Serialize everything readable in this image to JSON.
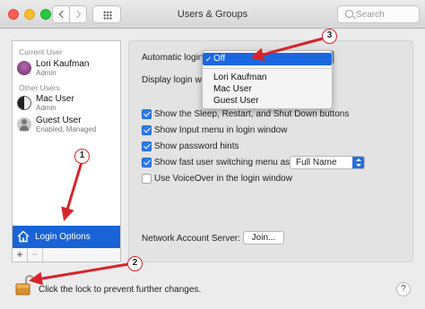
{
  "window": {
    "title": "Users & Groups",
    "search_placeholder": "Search"
  },
  "sidebar": {
    "current_user_header": "Current User",
    "other_users_header": "Other Users",
    "users": [
      {
        "name": "Lori Kaufman",
        "role": "Admin",
        "avatar": "photo-avatar"
      },
      {
        "name": "Mac User",
        "role": "Admin",
        "avatar": "yin-yang-avatar"
      },
      {
        "name": "Guest User",
        "role": "Enabled, Managed",
        "avatar": "guest-avatar"
      }
    ],
    "login_options_label": "Login Options",
    "add_label": "+",
    "remove_label": "−"
  },
  "panel": {
    "automatic_login_label": "Automatic login:",
    "display_login_label": "Display login window as:",
    "automatic_login_value": "Off",
    "dropdown_options": [
      "Off",
      "Lori Kaufman",
      "Mac User",
      "Guest User"
    ],
    "options": [
      {
        "label": "Show the Sleep, Restart, and Shut Down buttons",
        "checked": true
      },
      {
        "label": "Show Input menu in login window",
        "checked": true
      },
      {
        "label": "Show password hints",
        "checked": true
      },
      {
        "label": "Show fast user switching menu as",
        "checked": true
      },
      {
        "label": "Use VoiceOver in the login window",
        "checked": false
      }
    ],
    "fast_switch_value": "Full Name",
    "network_server_label": "Network Account Server:",
    "join_label": "Join..."
  },
  "footer": {
    "lock_text": "Click the lock to prevent further changes.",
    "help_label": "?"
  },
  "annotations": {
    "callouts": [
      "1",
      "2",
      "3"
    ],
    "color": "#d6242b"
  },
  "colors": {
    "selection_blue": "#1a63d6",
    "checkbox_blue": "#2d7bf0"
  }
}
